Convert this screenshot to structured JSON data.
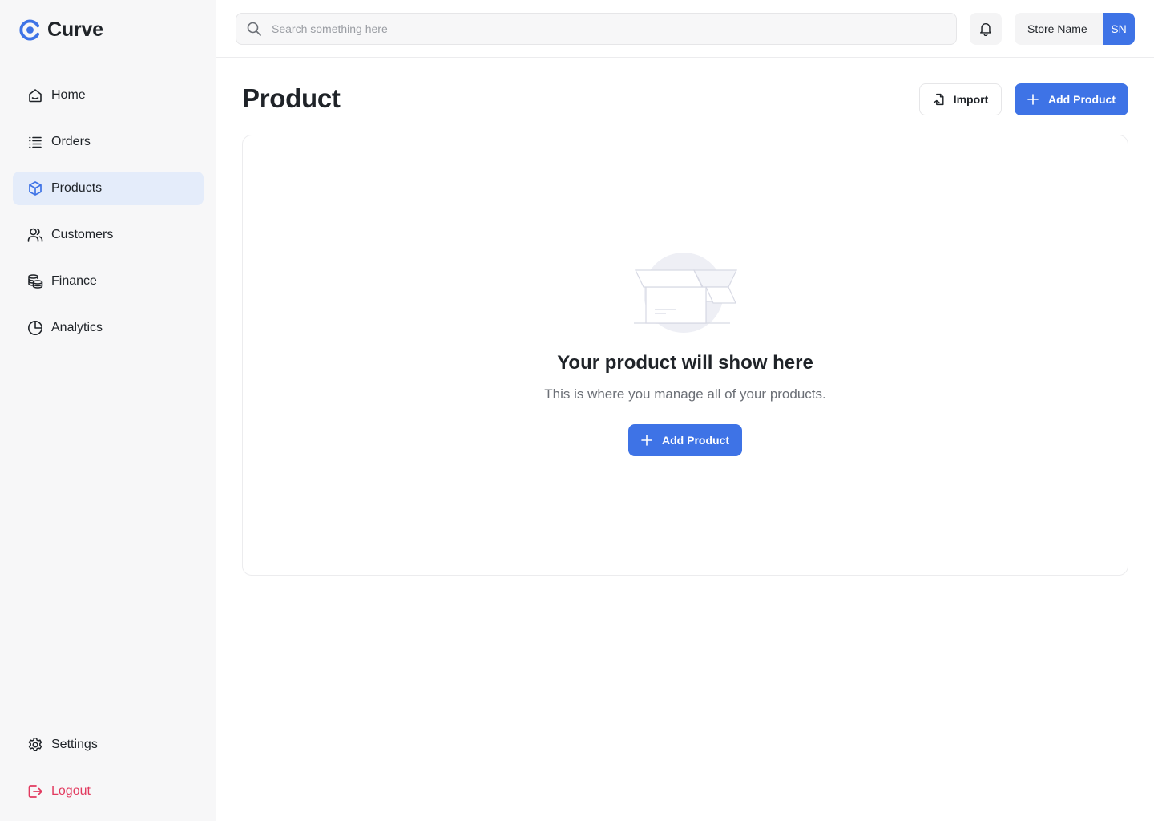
{
  "app": {
    "name": "Curve",
    "brand_color": "#3e73e6",
    "danger_color": "#e23a5f"
  },
  "sidebar": {
    "items": [
      {
        "label": "Home",
        "icon": "home-icon",
        "active": false
      },
      {
        "label": "Orders",
        "icon": "list-icon",
        "active": false
      },
      {
        "label": "Products",
        "icon": "box-icon",
        "active": true
      },
      {
        "label": "Customers",
        "icon": "users-icon",
        "active": false
      },
      {
        "label": "Finance",
        "icon": "coins-icon",
        "active": false
      },
      {
        "label": "Analytics",
        "icon": "pie-chart-icon",
        "active": false
      }
    ],
    "bottom": {
      "settings_label": "Settings",
      "logout_label": "Logout"
    }
  },
  "header": {
    "search_placeholder": "Search something here",
    "store_name": "Store Name",
    "avatar_initials": "SN"
  },
  "main": {
    "title": "Product",
    "import_label": "Import",
    "add_product_label": "Add Product",
    "empty_state": {
      "title": "Your product will show here",
      "subtitle": "This is where you manage all of your products.",
      "button_label": "Add Product"
    }
  }
}
